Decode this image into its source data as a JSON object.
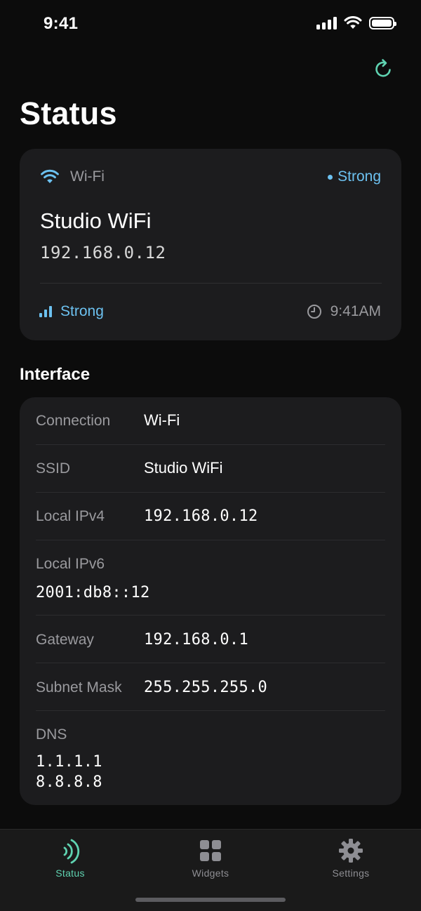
{
  "status_bar": {
    "time": "9:41"
  },
  "page": {
    "title": "Status"
  },
  "network_card": {
    "connection_type": "Wi-Fi",
    "badge": "Strong",
    "ssid": "Studio WiFi",
    "ip": "192.168.0.12",
    "signal_label": "Strong",
    "signal_level": 3,
    "signal_max": 3,
    "timestamp": "9:41AM"
  },
  "interface": {
    "title": "Interface",
    "rows": [
      {
        "label": "Connection",
        "value": "Wi-Fi"
      },
      {
        "label": "SSID",
        "value": "Studio WiFi"
      },
      {
        "label": "Local IPv4",
        "value": "192.168.0.12"
      },
      {
        "label": "Local IPv6",
        "value": "2001:db8::12"
      },
      {
        "label": "Gateway",
        "value": "192.168.0.1"
      },
      {
        "label": "Subnet Mask",
        "value": "255.255.255.0"
      },
      {
        "label": "DNS",
        "values": [
          "1.1.1.1",
          "8.8.8.8"
        ]
      }
    ]
  },
  "tabs": [
    {
      "label": "Status",
      "icon": "signal-waves-icon",
      "active": true
    },
    {
      "label": "Widgets",
      "icon": "grid-icon",
      "active": false
    },
    {
      "label": "Settings",
      "icon": "gear-icon",
      "active": false
    }
  ],
  "colors": {
    "accent": "#5fd3b1",
    "signal": "#6cc1f0",
    "card": "#1c1c1e",
    "background": "#0c0c0c"
  }
}
